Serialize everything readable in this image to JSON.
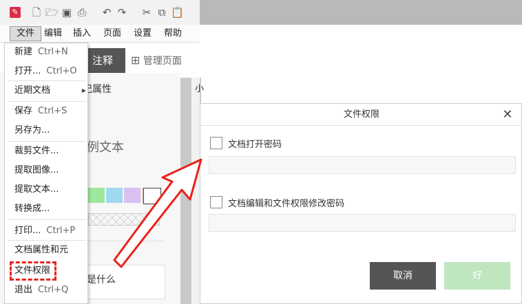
{
  "toolbar": {
    "icons": [
      "app-icon",
      "new-icon",
      "open-icon",
      "save-icon",
      "print-icon",
      "undo-icon",
      "redo-icon",
      "cut-icon",
      "copy-icon",
      "paste-icon"
    ]
  },
  "menubar": {
    "items": [
      "文件",
      "编辑",
      "插入",
      "页面",
      "设置",
      "帮助"
    ]
  },
  "background": {
    "annotate_label": "注释",
    "manage_pages_label": "管理页面",
    "panel_header": "字标记属性",
    "small_tab": "小",
    "sample_text": "例文本",
    "what_text": "是什么",
    "swatch_colors": [
      "#9ee89e",
      "#9fd8f0",
      "#d8c0f0",
      "#e0d0c0",
      "#ffffff"
    ]
  },
  "file_menu": {
    "new": {
      "label": "新建",
      "shortcut": "Ctrl+N"
    },
    "open": {
      "label": "打开...",
      "shortcut": "Ctrl+O"
    },
    "recent": {
      "label": "近期文档"
    },
    "save": {
      "label": "保存",
      "shortcut": "Ctrl+S"
    },
    "save_as": {
      "label": "另存为..."
    },
    "crop": {
      "label": "裁剪文件..."
    },
    "extract_images": {
      "label": "提取图像..."
    },
    "extract_text": {
      "label": "提取文本..."
    },
    "convert": {
      "label": "转换成..."
    },
    "print": {
      "label": "打印...",
      "shortcut": "Ctrl+P"
    },
    "properties": {
      "label": "文档属性和元"
    },
    "permissions": {
      "label": "文件权限"
    },
    "exit": {
      "label": "退出",
      "shortcut": "Ctrl+Q"
    }
  },
  "dialog": {
    "title": "文件权限",
    "open_password_label": "文档打开密码",
    "edit_password_label": "文档编辑和文件权限修改密码",
    "cancel_label": "取消",
    "ok_label": "好"
  },
  "colors": {
    "highlight": "#e8221b",
    "accent_ok": "#bfe6bf",
    "cancel_bg": "#555555"
  }
}
